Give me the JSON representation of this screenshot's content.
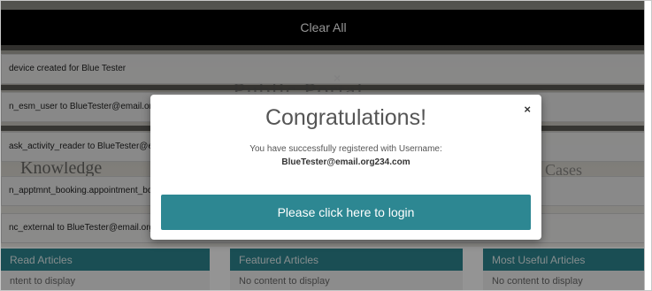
{
  "notifications": {
    "clear_all_label": "Clear All",
    "items": [
      "device created for Blue Tester",
      "n_esm_user to BlueTester@email.org2",
      "ask_activity_reader to BlueTester@em",
      "n_apptmnt_booking.appointment_bo",
      "nc_external to BlueTester@email.org2"
    ]
  },
  "background": {
    "portal_title": "Public Portal",
    "knowledge_title": "Knowledge",
    "cases_title": "Cases",
    "close_glyph": "×",
    "columns": [
      {
        "header": "Read Articles",
        "body": "ntent to display"
      },
      {
        "header": "Featured Articles",
        "body": "No content to display"
      },
      {
        "header": "Most Useful Articles",
        "body": "No content to display"
      }
    ]
  },
  "modal": {
    "title": "Congratulations!",
    "message": "You have successfully registered with Username:",
    "username": "BlueTester@email.org234.com",
    "button_label": "Please click here to login",
    "close_glyph": "×"
  }
}
